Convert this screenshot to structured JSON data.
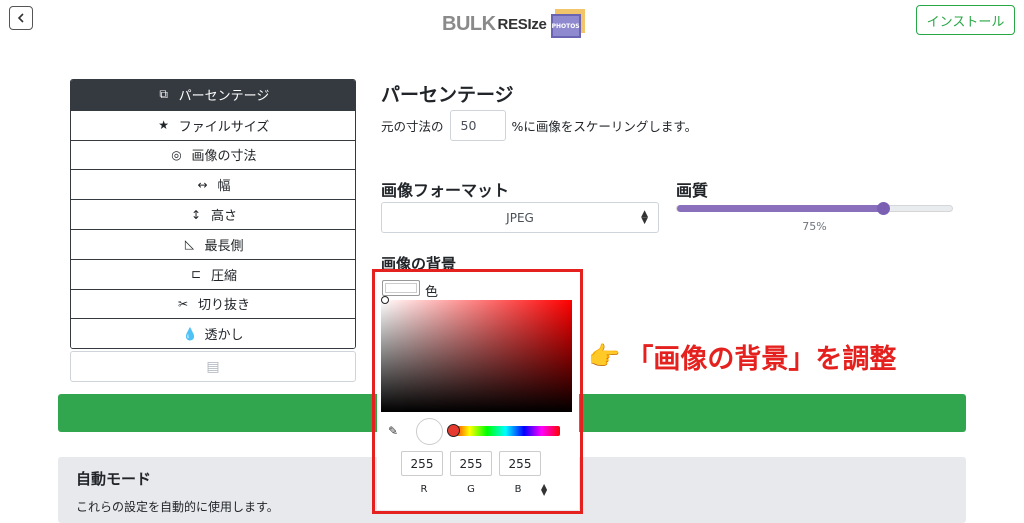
{
  "header": {
    "back_icon": "chevron-left-icon",
    "logo_word1": "BULK",
    "logo_word2": "RESIze",
    "logo_badge": "PHOTOS",
    "install_label": "インストール"
  },
  "sidebar": {
    "items": [
      {
        "label": "パーセンテージ",
        "icon": "crop-icon",
        "glyph": "⧉",
        "active": true
      },
      {
        "label": "ファイルサイズ",
        "icon": "star-icon",
        "glyph": "★"
      },
      {
        "label": "画像の寸法",
        "icon": "target-icon",
        "glyph": "◎"
      },
      {
        "label": "幅",
        "icon": "horizontal-arrows-icon",
        "glyph": "↔"
      },
      {
        "label": "高さ",
        "icon": "vertical-arrows-icon",
        "glyph": "↕"
      },
      {
        "label": "最長側",
        "icon": "triangle-ruler-icon",
        "glyph": "◺"
      },
      {
        "label": "圧縮",
        "icon": "compress-icon",
        "glyph": "⊏"
      },
      {
        "label": "切り抜き",
        "icon": "scissors-icon",
        "glyph": "✂"
      },
      {
        "label": "透かし",
        "icon": "droplet-icon",
        "glyph": "💧"
      }
    ],
    "extra_icon": "list-icon",
    "extra_glyph": "▤"
  },
  "percentage": {
    "title": "パーセンテージ",
    "prefix": "元の寸法の",
    "value": "50",
    "suffix": "%に画像をスケーリングします。"
  },
  "format": {
    "title": "画像フォーマット",
    "selected": "JPEG"
  },
  "quality": {
    "title": "画質",
    "value": 0.75,
    "label": "75%",
    "color": "#8a6fbd"
  },
  "background": {
    "title": "画像の背景",
    "color_label": "色",
    "picker": {
      "r": "255",
      "g": "255",
      "b": "255",
      "r_label": "R",
      "g_label": "G",
      "b_label": "B",
      "hue_color": "#ff0000"
    }
  },
  "auto_mode": {
    "title": "自動モード",
    "description": "これらの設定を自動的に使用します。"
  },
  "annotation": {
    "text": "「画像の背景」を調整",
    "hand_icon": "pointing-hand-icon",
    "hand_glyph": "👉",
    "color": "#e4211e"
  },
  "colors": {
    "accent_green": "#31a64e",
    "dark": "#343a40"
  }
}
